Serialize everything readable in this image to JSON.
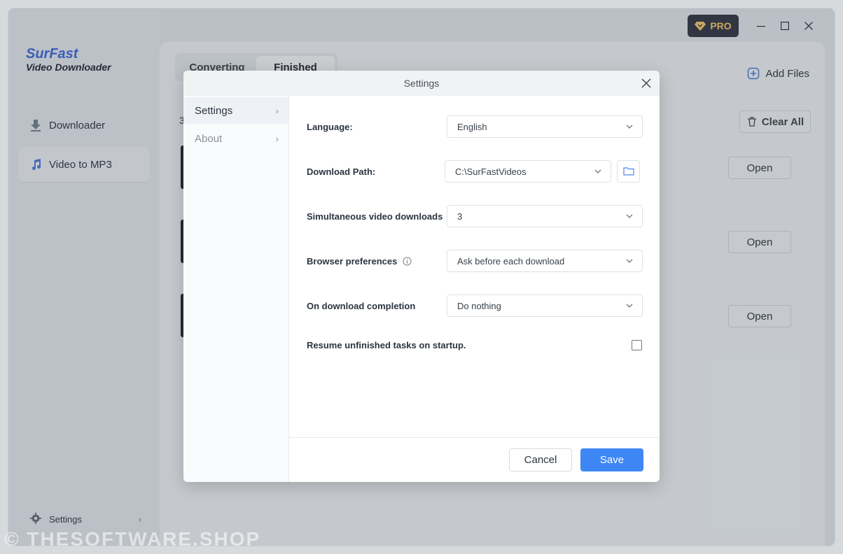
{
  "app": {
    "logo_title": "SurFast",
    "logo_subtitle": "Video Downloader",
    "pro_label": "PRO"
  },
  "sidebar": {
    "items": [
      {
        "label": "Downloader",
        "icon": "download-icon"
      },
      {
        "label": "Video to MP3",
        "icon": "music-note-icon"
      }
    ],
    "settings_label": "Settings"
  },
  "main": {
    "tabs": [
      {
        "label": "Converting"
      },
      {
        "label": "Finished"
      }
    ],
    "add_files_label": "Add Files",
    "clear_all_label": "Clear All",
    "count_fragment": "3",
    "open_label": "Open"
  },
  "dialog": {
    "title": "Settings",
    "nav": [
      {
        "label": "Settings"
      },
      {
        "label": "About"
      }
    ],
    "fields": {
      "language": {
        "label": "Language:",
        "value": "English"
      },
      "download_path": {
        "label": "Download Path:",
        "value": "C:\\SurFastVideos"
      },
      "simultaneous": {
        "label": "Simultaneous video downloads",
        "value": "3"
      },
      "browser": {
        "label": "Browser preferences",
        "value": "Ask before each download"
      },
      "completion": {
        "label": "On download completion",
        "value": "Do nothing"
      },
      "resume": {
        "label": "Resume unfinished tasks on startup.",
        "checked": false
      }
    },
    "cancel_label": "Cancel",
    "save_label": "Save"
  },
  "watermark": "© THESOFTWARE.SHOP",
  "colors": {
    "accent": "#3f86f5",
    "brand": "#3b66d6",
    "pro_bg": "#2f3440",
    "pro_text": "#f4c56a"
  }
}
